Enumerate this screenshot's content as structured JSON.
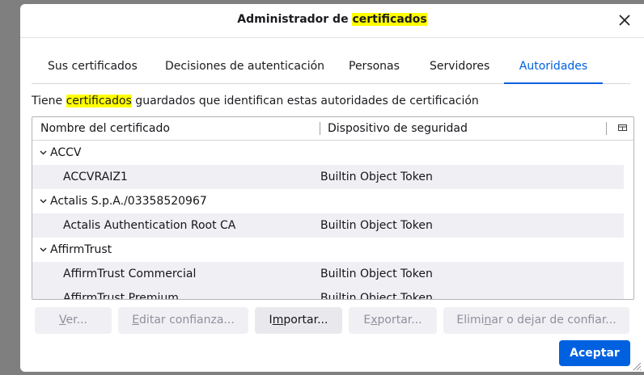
{
  "dialog": {
    "title_prefix": "Administrador de ",
    "title_highlight": "certificados"
  },
  "tabs": [
    {
      "label": "Sus certificados"
    },
    {
      "label": "Decisiones de autenticación"
    },
    {
      "label": "Personas"
    },
    {
      "label": "Servidores"
    },
    {
      "label": "Autoridades",
      "active": true
    }
  ],
  "description": {
    "before": "Tiene ",
    "highlight": "certificados",
    "after": " guardados que identifican estas autoridades de certificación"
  },
  "tree": {
    "columns": [
      "Nombre del certificado",
      "Dispositivo de seguridad"
    ],
    "rows": [
      {
        "type": "group",
        "name": "ACCV",
        "device": ""
      },
      {
        "type": "child",
        "name": "ACCVRAIZ1",
        "device": "Builtin Object Token"
      },
      {
        "type": "group",
        "name": "Actalis S.p.A./03358520967",
        "device": ""
      },
      {
        "type": "child",
        "name": "Actalis Authentication Root CA",
        "device": "Builtin Object Token"
      },
      {
        "type": "group",
        "name": "AffirmTrust",
        "device": ""
      },
      {
        "type": "child",
        "name": "AffirmTrust Commercial",
        "device": "Builtin Object Token"
      },
      {
        "type": "child",
        "name": "AffirmTrust Premium",
        "device": "Builtin Object Token"
      }
    ]
  },
  "buttons": {
    "view": {
      "u": "V",
      "rest": "er..."
    },
    "edit": {
      "pre": "",
      "u": "E",
      "rest": "ditar confianza..."
    },
    "import": {
      "pre": "I",
      "u": "m",
      "rest": "portar..."
    },
    "export": {
      "pre": "E",
      "u": "x",
      "rest": "portar..."
    },
    "delete": {
      "pre": "Elimi",
      "u": "n",
      "rest": "ar o dejar de confiar..."
    },
    "accept": "Aceptar"
  },
  "colors": {
    "accent": "#0061e0",
    "highlight": "#ffff00"
  }
}
